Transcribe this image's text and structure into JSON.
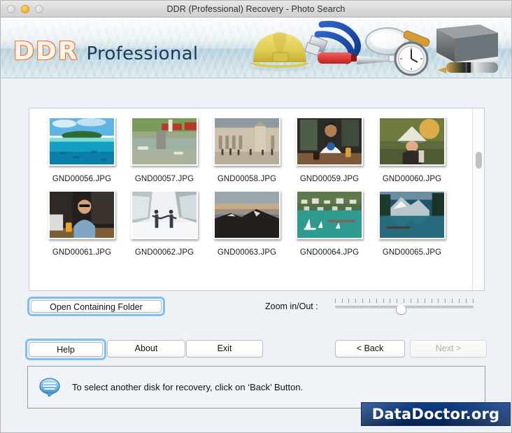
{
  "window": {
    "title": "DDR (Professional) Recovery - Photo Search",
    "traffic_lights": [
      "close",
      "minimize",
      "zoom"
    ]
  },
  "banner": {
    "logo_primary": "DDR",
    "logo_secondary": "Professional",
    "logo_primary_color": "#f0762c",
    "logo_secondary_color": "#1e3a5c",
    "icons": [
      "hard-hat-icon",
      "pliers-icon",
      "screwdriver-icon",
      "magnifier-icon",
      "stopwatch-icon",
      "book-icon",
      "pen-icon"
    ]
  },
  "thumbnails": {
    "rows": [
      [
        {
          "filename": "GND00056.JPG",
          "scene": "tropical-island-underwater"
        },
        {
          "filename": "GND00057.JPG",
          "scene": "city-river-bridge-aerial"
        },
        {
          "filename": "GND00058.JPG",
          "scene": "palace-plaza-tourists"
        },
        {
          "filename": "GND00059.JPG",
          "scene": "man-cafe-portrait"
        },
        {
          "filename": "GND00060.JPG",
          "scene": "woman-conical-hat-sunset"
        }
      ],
      [
        {
          "filename": "GND00061.JPG",
          "scene": "woman-sunglasses-bar"
        },
        {
          "filename": "GND00062.JPG",
          "scene": "couple-snowy-road"
        },
        {
          "filename": "GND00063.JPG",
          "scene": "mountain-peak-dusk"
        },
        {
          "filename": "GND00064.JPG",
          "scene": "harbour-town-boats"
        },
        {
          "filename": "GND00065.JPG",
          "scene": "alpine-lake-reflection"
        }
      ]
    ],
    "scrollbar": {
      "orientation": "vertical",
      "thumb_position_pct": 24
    }
  },
  "controls": {
    "open_containing_folder": "Open Containing Folder",
    "zoom_label": "Zoom in/Out :",
    "zoom_slider": {
      "ticks": 21,
      "value_pct": 47
    }
  },
  "buttons": {
    "help": "Help",
    "about": "About",
    "exit": "Exit",
    "back": "< Back",
    "next": "Next >",
    "next_disabled": true,
    "focused": [
      "open-containing-folder-button",
      "help-button"
    ],
    "focus_ring_color": "#7fc0f2"
  },
  "status": {
    "icon": "speech-bubble-icon",
    "message": "To select another disk for recovery, click on ‘Back’ Button."
  },
  "watermark": {
    "text": "DataDoctor.org",
    "background_color": "#0a2f6d",
    "text_color": "#ffffff"
  }
}
